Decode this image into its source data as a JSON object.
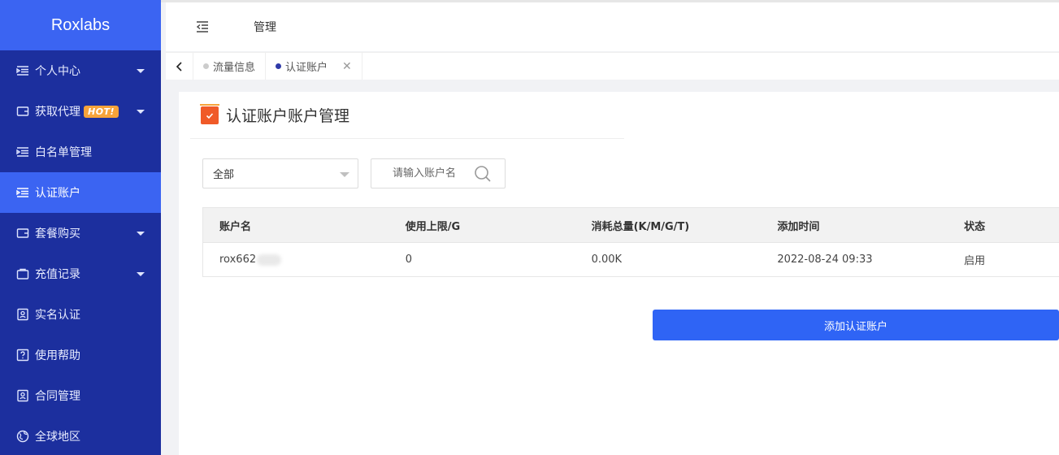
{
  "brand": "Roxlabs",
  "header": {
    "title": "管理"
  },
  "sidebar": {
    "items": [
      {
        "label": "个人中心",
        "icon": "list-icon",
        "has_caret": true
      },
      {
        "label": "获取代理",
        "icon": "wallet-icon",
        "badge": "HOT!",
        "has_caret": true
      },
      {
        "label": "白名单管理",
        "icon": "list-icon"
      },
      {
        "label": "认证账户",
        "icon": "list-icon",
        "active": true
      },
      {
        "label": "套餐购买",
        "icon": "wallet-icon",
        "has_caret": true
      },
      {
        "label": "充值记录",
        "icon": "bag-icon",
        "has_caret": true
      },
      {
        "label": "实名认证",
        "icon": "id-card-icon"
      },
      {
        "label": "使用帮助",
        "icon": "help-icon"
      },
      {
        "label": "合同管理",
        "icon": "id-card-icon"
      },
      {
        "label": "全球地区",
        "icon": "globe-icon"
      }
    ]
  },
  "tabs": [
    {
      "label": "流量信息"
    },
    {
      "label": "认证账户",
      "active": true
    }
  ],
  "page": {
    "title": "认证账户账户管理",
    "filter_value": "全部",
    "search_placeholder": "请输入账户名"
  },
  "table": {
    "headers": [
      "账户名",
      "使用上限/G",
      "消耗总量(K/M/G/T)",
      "添加时间",
      "状态"
    ],
    "rows": [
      {
        "account": "rox662",
        "limit": "0",
        "usage": "0.00K",
        "added": "2022-08-24 09:33",
        "status": "启用"
      }
    ]
  },
  "actions": {
    "add_button": "添加认证账户"
  },
  "colors": {
    "sidebar": "#1c2f9e",
    "accent": "#3b64f2",
    "button": "#2f64f5",
    "title_icon": "#f05a28",
    "hot_badge": "#f7a33a"
  }
}
